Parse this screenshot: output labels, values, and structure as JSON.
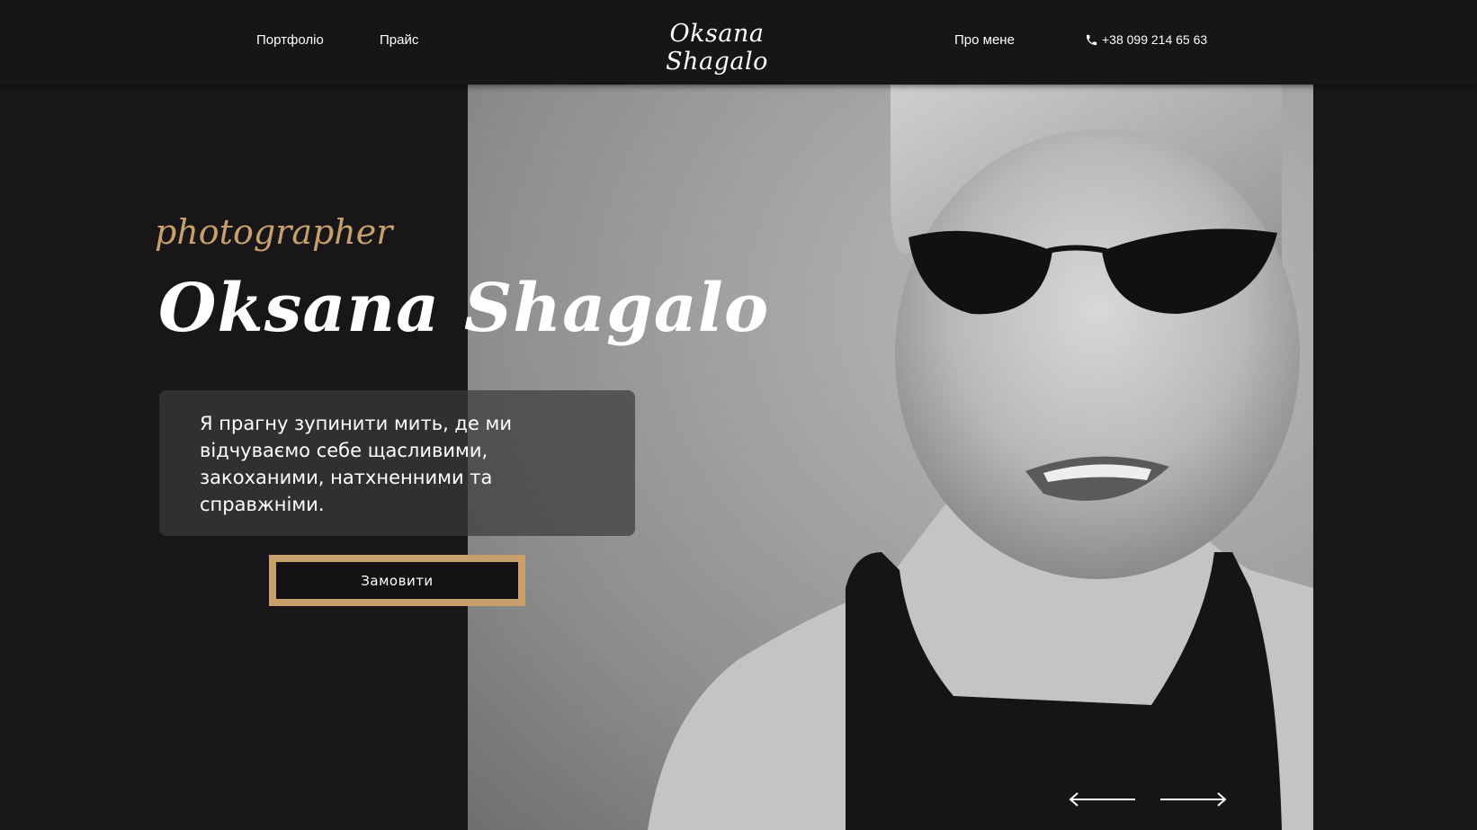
{
  "header": {
    "nav_left": [
      "Портфоліо",
      "Прайс"
    ],
    "logo": "Oksana Shagalo",
    "nav_about": "Про мене",
    "phone": "+38 099 214 65 63"
  },
  "hero": {
    "subtitle": "photographer",
    "title": "Oksana Shagalo",
    "quote": "Я прагну зупинити мить, де ми відчуваємо себе щасливими, закоханими, натхненними та справжніми.",
    "button_label": "Замовити",
    "photo": "black-and-white portrait photo"
  },
  "colors": {
    "background": "#181618",
    "accent": "#c9a06b",
    "text": "#ffffff"
  },
  "icons": [
    "phone-icon",
    "arrow-left-icon",
    "arrow-right-icon"
  ]
}
